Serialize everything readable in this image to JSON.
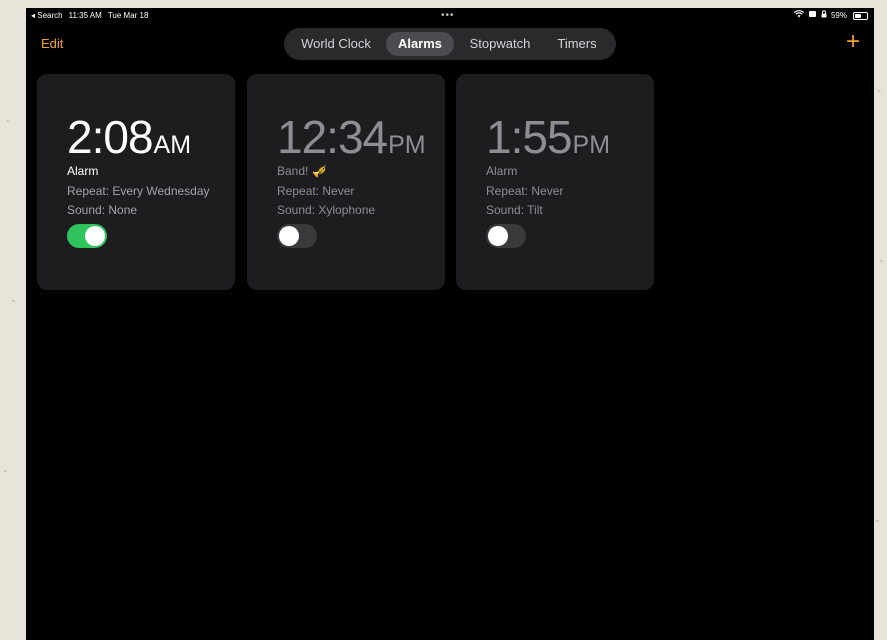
{
  "status_bar": {
    "back_label": "◂ Search",
    "time": "11:35 AM",
    "date": "Tue Mar 18",
    "dots": "•••",
    "battery_percent": "59%"
  },
  "nav": {
    "edit_label": "Edit",
    "add_label": "+"
  },
  "tabs": [
    {
      "label": "World Clock",
      "active": false
    },
    {
      "label": "Alarms",
      "active": true
    },
    {
      "label": "Stopwatch",
      "active": false
    },
    {
      "label": "Timers",
      "active": false
    }
  ],
  "alarms": [
    {
      "time": "2:08",
      "ampm": "AM",
      "label": "Alarm",
      "repeat": "Repeat: Every Wednesday",
      "sound": "Sound: None",
      "enabled": true
    },
    {
      "time": "12:34",
      "ampm": "PM",
      "label": "Band!",
      "label_emoji": "🎺",
      "repeat": "Repeat: Never",
      "sound": "Sound: Xylophone",
      "enabled": false
    },
    {
      "time": "1:55",
      "ampm": "PM",
      "label": "Alarm",
      "repeat": "Repeat: Never",
      "sound": "Sound: Tilt",
      "enabled": false
    }
  ],
  "colors": {
    "accent": "#f4a02a",
    "toggle_on": "#31c35c",
    "card_bg": "#1d1d20"
  }
}
